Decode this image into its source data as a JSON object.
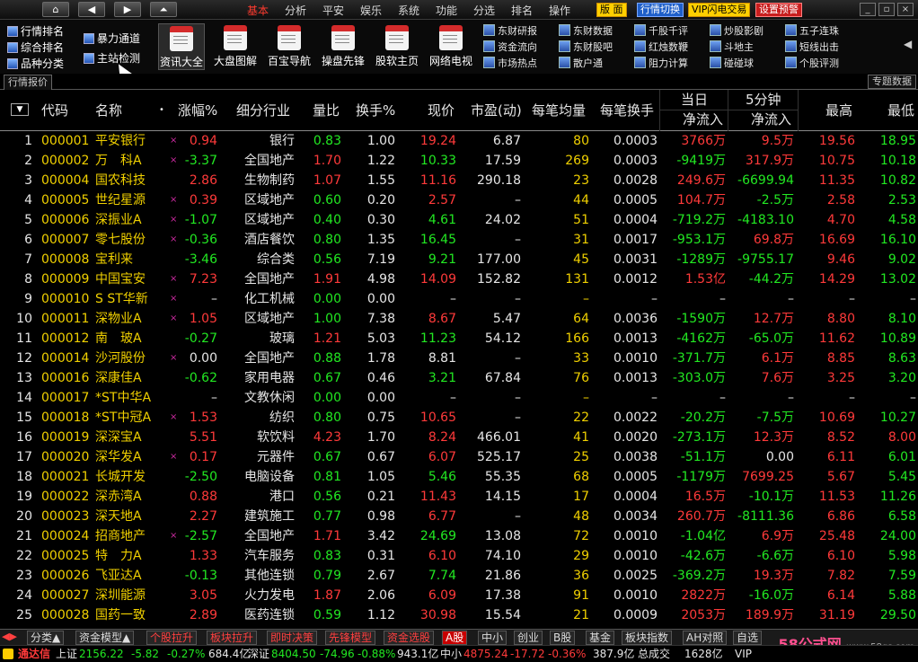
{
  "menu": [
    "基本",
    "分析",
    "平安",
    "娱乐",
    "系统",
    "功能",
    "分选",
    "排名",
    "操作"
  ],
  "menu_active": 0,
  "top_highlights": [
    "版 面",
    "行情切换",
    "VIP闪电交易",
    "设置预警"
  ],
  "toolbar_left": [
    "行情排名",
    "综合排名",
    "品种分类"
  ],
  "toolbar_left2": [
    "暴力通道",
    "主站检测"
  ],
  "toolbar_big": [
    "资讯大全",
    "大盘图解",
    "百宝导航",
    "操盘先锋",
    "股软主页",
    "网络电视"
  ],
  "toolbar_small": [
    [
      "东财研报",
      "资金流向",
      "市场热点"
    ],
    [
      "东财数据",
      "东财股吧",
      "散户通"
    ],
    [
      "千股千评",
      "红烛数鞭",
      "阻力计算"
    ],
    [
      "炒股影剧",
      "斗地主",
      "碰碰球"
    ],
    [
      "五子连珠",
      "短线出击",
      "个股评测"
    ]
  ],
  "tabs": {
    "left": "行情报价",
    "right": "专题数据"
  },
  "headers": {
    "code": "代码",
    "name": "名称",
    "change": "涨幅%",
    "industry": "细分行业",
    "volratio": "量比",
    "turnover": "换手%",
    "price": "现价",
    "pe": "市盈(动)",
    "avgvol": "每笔均量",
    "avgturn": "每笔换手",
    "today": "当日",
    "five": "5分钟",
    "netin": "净流入",
    "netin2": "净流入",
    "high": "最高",
    "low": "最低"
  },
  "rows": [
    {
      "n": "1",
      "code": "000001",
      "name": "平安银行",
      "dot": "×",
      "chg": "0.94",
      "ind": "银行",
      "vr": "0.83",
      "to": "1.00",
      "px": "19.24",
      "pe": "6.87",
      "av": "80",
      "at": "0.0003",
      "ni": "3766万",
      "n5": "9.5万",
      "hi": "19.56",
      "lo": "18.95",
      "cc": "red",
      "pc": "red",
      "vc": "grn",
      "nc": "red",
      "n5c": "red",
      "hc": "red",
      "lc": "grn"
    },
    {
      "n": "2",
      "code": "000002",
      "name": "万　科A",
      "dot": "×",
      "chg": "-3.37",
      "ind": "全国地产",
      "vr": "1.70",
      "to": "1.22",
      "px": "10.33",
      "pe": "17.59",
      "av": "269",
      "at": "0.0003",
      "ni": "-9419万",
      "n5": "317.9万",
      "hi": "10.75",
      "lo": "10.18",
      "cc": "grn",
      "pc": "grn",
      "vc": "red",
      "nc": "grn",
      "n5c": "red",
      "hc": "red",
      "lc": "grn"
    },
    {
      "n": "3",
      "code": "000004",
      "name": "国农科技",
      "dot": "",
      "chg": "2.86",
      "ind": "生物制药",
      "vr": "1.07",
      "to": "1.55",
      "px": "11.16",
      "pe": "290.18",
      "av": "23",
      "at": "0.0028",
      "ni": "249.6万",
      "n5": "-6699.94",
      "hi": "11.35",
      "lo": "10.82",
      "cc": "red",
      "pc": "red",
      "vc": "red",
      "nc": "red",
      "n5c": "grn",
      "hc": "red",
      "lc": "grn"
    },
    {
      "n": "4",
      "code": "000005",
      "name": "世纪星源",
      "dot": "×",
      "chg": "0.39",
      "ind": "区域地产",
      "vr": "0.60",
      "to": "0.20",
      "px": "2.57",
      "pe": "–",
      "av": "44",
      "at": "0.0005",
      "ni": "104.7万",
      "n5": "-2.5万",
      "hi": "2.58",
      "lo": "2.53",
      "cc": "red",
      "pc": "red",
      "vc": "grn",
      "nc": "red",
      "n5c": "grn",
      "hc": "red",
      "lc": "grn"
    },
    {
      "n": "5",
      "code": "000006",
      "name": "深振业A",
      "dot": "×",
      "chg": "-1.07",
      "ind": "区域地产",
      "vr": "0.40",
      "to": "0.30",
      "px": "4.61",
      "pe": "24.02",
      "av": "51",
      "at": "0.0004",
      "ni": "-719.2万",
      "n5": "-4183.10",
      "hi": "4.70",
      "lo": "4.58",
      "cc": "grn",
      "pc": "grn",
      "vc": "grn",
      "nc": "grn",
      "n5c": "grn",
      "hc": "red",
      "lc": "grn"
    },
    {
      "n": "6",
      "code": "000007",
      "name": "零七股份",
      "dot": "×",
      "chg": "-0.36",
      "ind": "酒店餐饮",
      "vr": "0.80",
      "to": "1.35",
      "px": "16.45",
      "pe": "–",
      "av": "31",
      "at": "0.0017",
      "ni": "-953.1万",
      "n5": "69.8万",
      "hi": "16.69",
      "lo": "16.10",
      "cc": "grn",
      "pc": "grn",
      "vc": "grn",
      "nc": "grn",
      "n5c": "red",
      "hc": "red",
      "lc": "grn"
    },
    {
      "n": "7",
      "code": "000008",
      "name": "宝利来",
      "dot": "",
      "chg": "-3.46",
      "ind": "综合类",
      "vr": "0.56",
      "to": "7.19",
      "px": "9.21",
      "pe": "177.00",
      "av": "45",
      "at": "0.0031",
      "ni": "-1289万",
      "n5": "-9755.17",
      "hi": "9.46",
      "lo": "9.02",
      "cc": "grn",
      "pc": "grn",
      "vc": "grn",
      "nc": "grn",
      "n5c": "grn",
      "hc": "red",
      "lc": "grn"
    },
    {
      "n": "8",
      "code": "000009",
      "name": "中国宝安",
      "dot": "×",
      "chg": "7.23",
      "ind": "全国地产",
      "vr": "1.91",
      "to": "4.98",
      "px": "14.09",
      "pe": "152.82",
      "av": "131",
      "at": "0.0012",
      "ni": "1.53亿",
      "n5": "-44.2万",
      "hi": "14.29",
      "lo": "13.02",
      "cc": "red",
      "pc": "red",
      "vc": "red",
      "nc": "red",
      "n5c": "grn",
      "hc": "red",
      "lc": "grn"
    },
    {
      "n": "9",
      "code": "000010",
      "name": "S ST华新",
      "dot": "×",
      "chg": "–",
      "ind": "化工机械",
      "vr": "0.00",
      "to": "0.00",
      "px": "–",
      "pe": "–",
      "av": "–",
      "at": "–",
      "ni": "–",
      "n5": "–",
      "hi": "–",
      "lo": "–",
      "cc": "wht",
      "pc": "wht",
      "vc": "grn",
      "nc": "wht",
      "n5c": "wht",
      "hc": "wht",
      "lc": "wht"
    },
    {
      "n": "10",
      "code": "000011",
      "name": "深物业A",
      "dot": "×",
      "chg": "1.05",
      "ind": "区域地产",
      "vr": "1.00",
      "to": "7.38",
      "px": "8.67",
      "pe": "5.47",
      "av": "64",
      "at": "0.0036",
      "ni": "-1590万",
      "n5": "12.7万",
      "hi": "8.80",
      "lo": "8.10",
      "cc": "red",
      "pc": "red",
      "vc": "grn",
      "nc": "grn",
      "n5c": "red",
      "hc": "red",
      "lc": "grn"
    },
    {
      "n": "11",
      "code": "000012",
      "name": "南　玻A",
      "dot": "",
      "chg": "-0.27",
      "ind": "玻璃",
      "vr": "1.21",
      "to": "5.03",
      "px": "11.23",
      "pe": "54.12",
      "av": "166",
      "at": "0.0013",
      "ni": "-4162万",
      "n5": "-65.0万",
      "hi": "11.62",
      "lo": "10.89",
      "cc": "grn",
      "pc": "grn",
      "vc": "red",
      "nc": "grn",
      "n5c": "grn",
      "hc": "red",
      "lc": "grn"
    },
    {
      "n": "12",
      "code": "000014",
      "name": "沙河股份",
      "dot": "×",
      "chg": "0.00",
      "ind": "全国地产",
      "vr": "0.88",
      "to": "1.78",
      "px": "8.81",
      "pe": "–",
      "av": "33",
      "at": "0.0010",
      "ni": "-371.7万",
      "n5": "6.1万",
      "hi": "8.85",
      "lo": "8.63",
      "cc": "wht",
      "pc": "wht",
      "vc": "grn",
      "nc": "grn",
      "n5c": "red",
      "hc": "red",
      "lc": "grn"
    },
    {
      "n": "13",
      "code": "000016",
      "name": "深康佳A",
      "dot": "",
      "chg": "-0.62",
      "ind": "家用电器",
      "vr": "0.67",
      "to": "0.46",
      "px": "3.21",
      "pe": "67.84",
      "av": "76",
      "at": "0.0013",
      "ni": "-303.0万",
      "n5": "7.6万",
      "hi": "3.25",
      "lo": "3.20",
      "cc": "grn",
      "pc": "grn",
      "vc": "grn",
      "nc": "grn",
      "n5c": "red",
      "hc": "red",
      "lc": "grn"
    },
    {
      "n": "14",
      "code": "000017",
      "name": "*ST中华A",
      "dot": "",
      "chg": "–",
      "ind": "文教休闲",
      "vr": "0.00",
      "to": "0.00",
      "px": "–",
      "pe": "–",
      "av": "–",
      "at": "–",
      "ni": "–",
      "n5": "–",
      "hi": "–",
      "lo": "–",
      "cc": "wht",
      "pc": "wht",
      "vc": "grn",
      "nc": "wht",
      "n5c": "wht",
      "hc": "wht",
      "lc": "wht"
    },
    {
      "n": "15",
      "code": "000018",
      "name": "*ST中冠A",
      "dot": "×",
      "chg": "1.53",
      "ind": "纺织",
      "vr": "0.80",
      "to": "0.75",
      "px": "10.65",
      "pe": "–",
      "av": "22",
      "at": "0.0022",
      "ni": "-20.2万",
      "n5": "-7.5万",
      "hi": "10.69",
      "lo": "10.27",
      "cc": "red",
      "pc": "red",
      "vc": "grn",
      "nc": "grn",
      "n5c": "grn",
      "hc": "red",
      "lc": "grn"
    },
    {
      "n": "16",
      "code": "000019",
      "name": "深深宝A",
      "dot": "",
      "chg": "5.51",
      "ind": "软饮料",
      "vr": "4.23",
      "to": "1.70",
      "px": "8.24",
      "pe": "466.01",
      "av": "41",
      "at": "0.0020",
      "ni": "-273.1万",
      "n5": "12.3万",
      "hi": "8.52",
      "lo": "8.00",
      "cc": "red",
      "pc": "red",
      "vc": "red",
      "nc": "grn",
      "n5c": "red",
      "hc": "red",
      "lc": "red"
    },
    {
      "n": "17",
      "code": "000020",
      "name": "深华发A",
      "dot": "×",
      "chg": "0.17",
      "ind": "元器件",
      "vr": "0.67",
      "to": "0.67",
      "px": "6.07",
      "pe": "525.17",
      "av": "25",
      "at": "0.0038",
      "ni": "-51.1万",
      "n5": "0.00",
      "hi": "6.11",
      "lo": "6.01",
      "cc": "red",
      "pc": "red",
      "vc": "grn",
      "nc": "grn",
      "n5c": "wht",
      "hc": "red",
      "lc": "grn"
    },
    {
      "n": "18",
      "code": "000021",
      "name": "长城开发",
      "dot": "",
      "chg": "-2.50",
      "ind": "电脑设备",
      "vr": "0.81",
      "to": "1.05",
      "px": "5.46",
      "pe": "55.35",
      "av": "68",
      "at": "0.0005",
      "ni": "-1179万",
      "n5": "7699.25",
      "hi": "5.67",
      "lo": "5.45",
      "cc": "grn",
      "pc": "grn",
      "vc": "grn",
      "nc": "grn",
      "n5c": "red",
      "hc": "red",
      "lc": "grn"
    },
    {
      "n": "19",
      "code": "000022",
      "name": "深赤湾A",
      "dot": "",
      "chg": "0.88",
      "ind": "港口",
      "vr": "0.56",
      "to": "0.21",
      "px": "11.43",
      "pe": "14.15",
      "av": "17",
      "at": "0.0004",
      "ni": "16.5万",
      "n5": "-10.1万",
      "hi": "11.53",
      "lo": "11.26",
      "cc": "red",
      "pc": "red",
      "vc": "grn",
      "nc": "red",
      "n5c": "grn",
      "hc": "red",
      "lc": "grn"
    },
    {
      "n": "20",
      "code": "000023",
      "name": "深天地A",
      "dot": "",
      "chg": "2.27",
      "ind": "建筑施工",
      "vr": "0.77",
      "to": "0.98",
      "px": "6.77",
      "pe": "–",
      "av": "48",
      "at": "0.0034",
      "ni": "260.7万",
      "n5": "-8111.36",
      "hi": "6.86",
      "lo": "6.58",
      "cc": "red",
      "pc": "red",
      "vc": "grn",
      "nc": "red",
      "n5c": "grn",
      "hc": "red",
      "lc": "grn"
    },
    {
      "n": "21",
      "code": "000024",
      "name": "招商地产",
      "dot": "×",
      "chg": "-2.57",
      "ind": "全国地产",
      "vr": "1.71",
      "to": "3.42",
      "px": "24.69",
      "pe": "13.08",
      "av": "72",
      "at": "0.0010",
      "ni": "-1.04亿",
      "n5": "6.9万",
      "hi": "25.48",
      "lo": "24.00",
      "cc": "grn",
      "pc": "grn",
      "vc": "red",
      "nc": "grn",
      "n5c": "red",
      "hc": "red",
      "lc": "grn"
    },
    {
      "n": "22",
      "code": "000025",
      "name": "特　力A",
      "dot": "",
      "chg": "1.33",
      "ind": "汽车服务",
      "vr": "0.83",
      "to": "0.31",
      "px": "6.10",
      "pe": "74.10",
      "av": "29",
      "at": "0.0010",
      "ni": "-42.6万",
      "n5": "-6.6万",
      "hi": "6.10",
      "lo": "5.98",
      "cc": "red",
      "pc": "red",
      "vc": "grn",
      "nc": "grn",
      "n5c": "grn",
      "hc": "red",
      "lc": "grn"
    },
    {
      "n": "23",
      "code": "000026",
      "name": "飞亚达A",
      "dot": "",
      "chg": "-0.13",
      "ind": "其他连锁",
      "vr": "0.79",
      "to": "2.67",
      "px": "7.74",
      "pe": "21.86",
      "av": "36",
      "at": "0.0025",
      "ni": "-369.2万",
      "n5": "19.3万",
      "hi": "7.82",
      "lo": "7.59",
      "cc": "grn",
      "pc": "grn",
      "vc": "grn",
      "nc": "grn",
      "n5c": "red",
      "hc": "red",
      "lc": "grn"
    },
    {
      "n": "24",
      "code": "000027",
      "name": "深圳能源",
      "dot": "",
      "chg": "3.05",
      "ind": "火力发电",
      "vr": "1.87",
      "to": "2.06",
      "px": "6.09",
      "pe": "17.38",
      "av": "91",
      "at": "0.0010",
      "ni": "2822万",
      "n5": "-16.0万",
      "hi": "6.14",
      "lo": "5.88",
      "cc": "red",
      "pc": "red",
      "vc": "red",
      "nc": "red",
      "n5c": "grn",
      "hc": "red",
      "lc": "grn"
    },
    {
      "n": "25",
      "code": "000028",
      "name": "国药一致",
      "dot": "",
      "chg": "2.89",
      "ind": "医药连锁",
      "vr": "0.59",
      "to": "1.12",
      "px": "30.98",
      "pe": "15.54",
      "av": "21",
      "at": "0.0009",
      "ni": "2053万",
      "n5": "189.9万",
      "hi": "31.19",
      "lo": "29.50",
      "cc": "red",
      "pc": "red",
      "vc": "grn",
      "nc": "red",
      "n5c": "red",
      "hc": "red",
      "lc": "grn"
    }
  ],
  "bottom_tabs": [
    "分类▲",
    "资金模型▲",
    "个股拉升",
    "板块拉升",
    "即时决策",
    "先锋模型",
    "资金选股",
    "A股",
    "中小",
    "创业",
    "B股",
    "基金",
    "板块指数",
    "AH对照",
    "自选"
  ],
  "status": {
    "brand": "通达信",
    "sh_label": "上证",
    "sh_idx": "2156.22",
    "sh_chg": "-5.82",
    "sh_pct": "-0.27%",
    "sh_amt": "684.4亿",
    "sz_label": "深证",
    "sz_idx": "8404.50",
    "sz_chg": "-74.96",
    "sz_pct": "-0.88%",
    "sz_amt": "943.1亿",
    "zx_label": "中小",
    "zx_idx": "4875.24",
    "zx_chg": "-17.72",
    "zx_pct": "-0.36%",
    "zx_amt": "387.9亿",
    "total_label": "总成交",
    "total_amt": "1628亿",
    "vip": "VIP"
  },
  "watermark": {
    "text": "58公式网",
    "url": "www.58gs.com"
  }
}
